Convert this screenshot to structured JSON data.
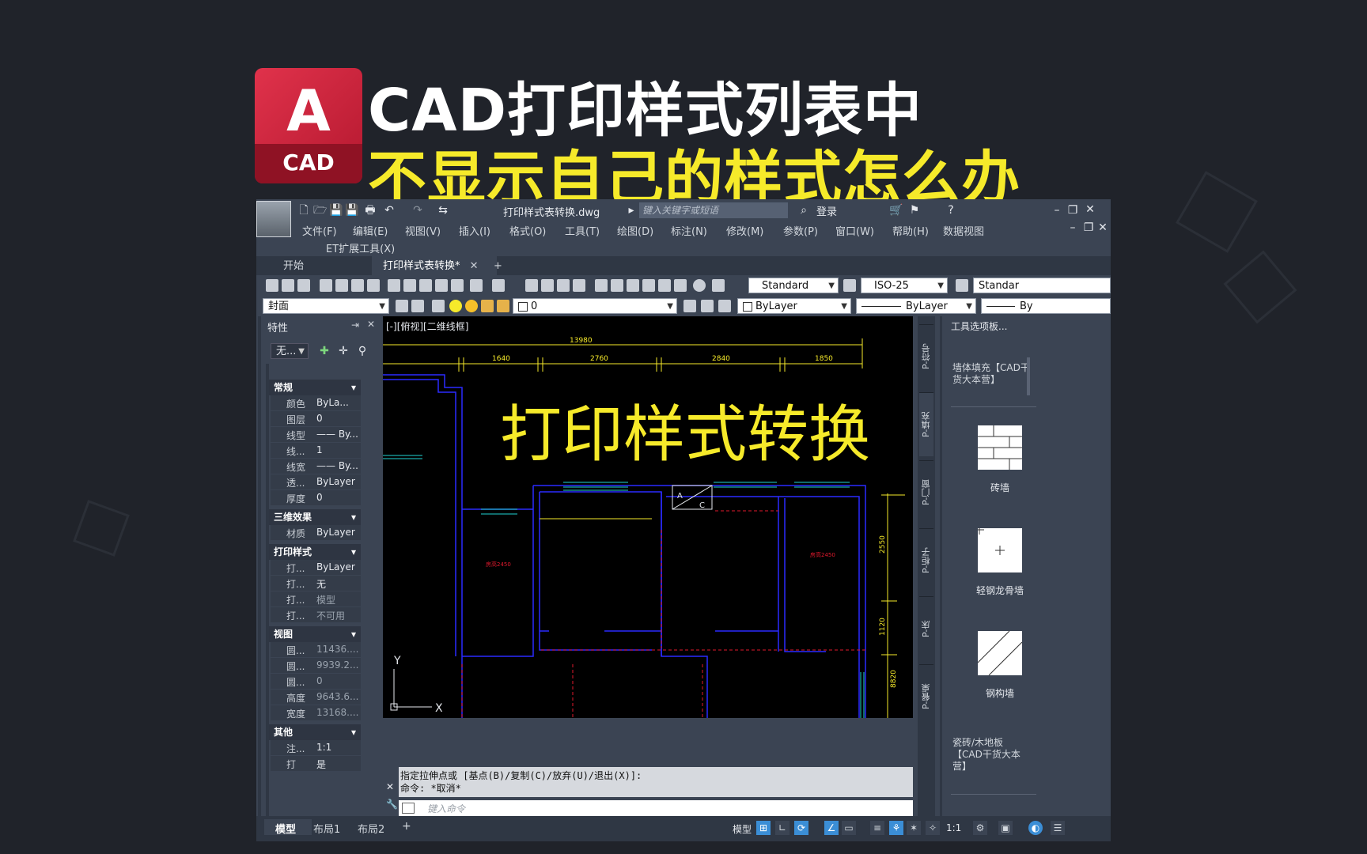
{
  "banner": {
    "logo_letter": "A",
    "logo_text": "CAD",
    "title_line1": "CAD打印样式列表中",
    "title_line2": "不显示自己的样式怎么办"
  },
  "titlebar": {
    "filename": "打印样式表转换.dwg",
    "search_placeholder": "键入关键字或短语",
    "login": "登录"
  },
  "menu": [
    "文件(F)",
    "编辑(E)",
    "视图(V)",
    "插入(I)",
    "格式(O)",
    "工具(T)",
    "绘图(D)",
    "标注(N)",
    "修改(M)",
    "参数(P)",
    "窗口(W)",
    "帮助(H)",
    "数据视图"
  ],
  "et_menu": "ET扩展工具(X)",
  "tabs": {
    "start": "开始",
    "doc": "打印样式表转换*",
    "close": "✕",
    "add": "+"
  },
  "toolbar": {
    "text_style": "Standard",
    "dim_style": "ISO-25",
    "table_style": "Standar",
    "layer_state": "封面",
    "layer": "0",
    "color": "ByLayer",
    "linetype": "ByLayer",
    "lineweight": "By"
  },
  "properties": {
    "title": "特性",
    "selector": "无...",
    "sections": {
      "general": "常规",
      "effects3d": "三维效果",
      "plotstyle": "打印样式",
      "view": "视图",
      "misc": "其他"
    },
    "general_rows": [
      {
        "k": "颜色",
        "v": "ByLa..."
      },
      {
        "k": "图层",
        "v": "0"
      },
      {
        "k": "线型",
        "v": "—— By..."
      },
      {
        "k": "线...",
        "v": "1"
      },
      {
        "k": "线宽",
        "v": "—— By..."
      },
      {
        "k": "透...",
        "v": "ByLayer"
      },
      {
        "k": "厚度",
        "v": "0"
      }
    ],
    "effects_rows": [
      {
        "k": "材质",
        "v": "ByLayer"
      }
    ],
    "plot_rows": [
      {
        "k": "打...",
        "v": "ByLayer"
      },
      {
        "k": "打...",
        "v": "无"
      },
      {
        "k": "打...",
        "v": "模型"
      },
      {
        "k": "打...",
        "v": "不可用"
      }
    ],
    "view_rows": [
      {
        "k": "圆...",
        "v": "11436...."
      },
      {
        "k": "圆...",
        "v": "9939.2..."
      },
      {
        "k": "圆...",
        "v": "0"
      },
      {
        "k": "高度",
        "v": "9643.6..."
      },
      {
        "k": "宽度",
        "v": "13168...."
      }
    ],
    "misc_rows": [
      {
        "k": "注...",
        "v": "1:1"
      },
      {
        "k": "打",
        "v": "是"
      }
    ]
  },
  "canvas": {
    "view_label": "[-][俯视][二维线框]",
    "overlay_text": "打印样式转换",
    "dims_top": "13980",
    "dims": [
      "1640",
      "2760",
      "2840",
      "1850"
    ],
    "dims_right": [
      "2550",
      "1120",
      "8820"
    ],
    "room_tags": [
      "房高2450",
      "房高2450"
    ],
    "block_a": "A",
    "block_c": "C",
    "axis_y": "Y",
    "axis_x": "X"
  },
  "command": {
    "line1": "指定拉伸点或 [基点(B)/复制(C)/放弃(U)/退出(X)]:",
    "line2": "命令: *取消*",
    "input_placeholder": "键入命令"
  },
  "side_tabs": [
    "P-符号",
    "P-填充",
    "P-门窗",
    "P-柜子",
    "P-床",
    "P-餐桌"
  ],
  "palette": {
    "title": "工具选项板...",
    "group1": "墙体填充【CAD干货大本营】",
    "items": [
      "砖墙",
      "轻钢龙骨墙",
      "钢构墙"
    ],
    "group2": "瓷砖/木地板【CAD干货大本营】"
  },
  "statusbar": {
    "tabs": [
      "模型",
      "布局1",
      "布局2"
    ],
    "add": "+",
    "model": "模型",
    "scale": "1:1"
  },
  "colors": {
    "accent": "#3b8ed6",
    "canvas": "#000000",
    "wall": "#2b2bff",
    "dim": "#f6ea2a",
    "red": "#e0192d",
    "cyan": "#1fd4d4"
  }
}
